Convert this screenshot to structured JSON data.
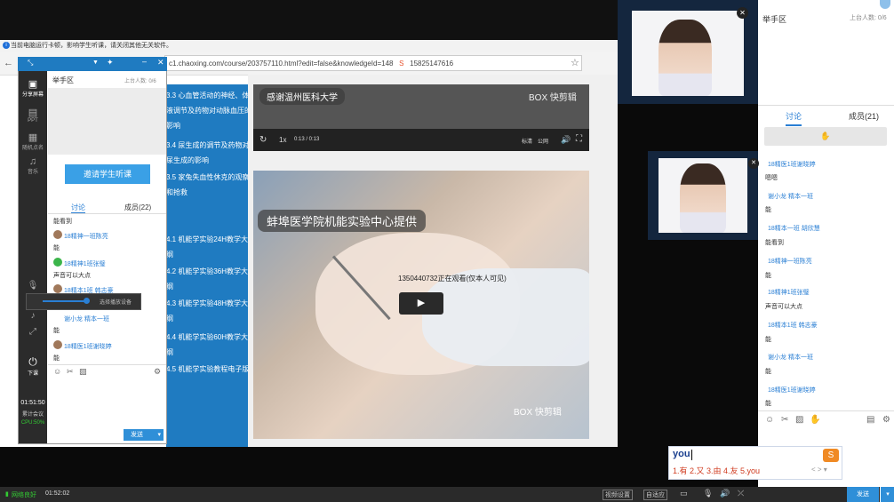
{
  "warning": "当前电脑运行卡顿，影响学生听课，请关闭其他无关软件。",
  "browser": {
    "url": "c1.chaoxing.com/course/203757110.html?edit=false&knowledgeId=148",
    "url_tail": "15825147616"
  },
  "tree": [
    "3.3 心血管活动的神经、体",
    "液调节及药物对动脉血压的",
    "影响",
    "3.4 尿生成的调节及药物对",
    "尿生成的影响",
    "3.5 家兔失血性休克的观察",
    "和抢救",
    "4.1 机能学实验24H教学大",
    "纲",
    "4.2 机能学实验36H教学大",
    "纲",
    "4.3 机能学实验48H教学大",
    "纲",
    "4.4 机能学实验60H教学大",
    "纲",
    "4.5 机能学实验教程电子版"
  ],
  "video1": {
    "tag": "感谢温州医科大学",
    "brand": "BOX 快剪辑",
    "speed": "1x",
    "time": "0:13 / 0:13",
    "mode": "标清",
    "public": "公网"
  },
  "video2": {
    "tag": "蚌埠医学院机能实验中心提供",
    "watermark": "1350440732正在观看(仅本人可见)",
    "brand": "BOX 快剪辑"
  },
  "panel": {
    "title": "举手区",
    "stage_count": "上台人数: 0/6",
    "invite": "邀请学生听课",
    "tab_discuss": "讨论",
    "tab_members": "成员(22)",
    "side": [
      "分享屏幕",
      "PPT",
      "随机点名",
      "音乐",
      "下课"
    ],
    "timer": "01:51:50",
    "timer_label": "累计会议",
    "cpu": "CPU:50%",
    "select_device": "选择播放设备",
    "send": "发送",
    "messages": [
      {
        "name": "",
        "text": "能看到"
      },
      {
        "name": "18精神一班陈亮",
        "text": "能"
      },
      {
        "name": "18精神1班张璧",
        "text": "声音可以大点"
      },
      {
        "name": "18精本1班 韩志豪",
        "text": ""
      },
      {
        "name": "谢小龙 精本一班",
        "text": "能"
      },
      {
        "name": "18精医1班谢晓婷",
        "text": "能"
      }
    ]
  },
  "right": {
    "title": "举手区",
    "stage_count": "上台人数: 0/6",
    "tab_discuss": "讨论",
    "tab_members": "成员(21)",
    "send": "发送",
    "messages": [
      {
        "name": "18精医1班谢晓婷",
        "text": "嗯嗯"
      },
      {
        "name": "谢小龙 精本一班",
        "text": "能"
      },
      {
        "name": "18精本一班 胡欣慧",
        "text": "能看到"
      },
      {
        "name": "18精神一班陈亮",
        "text": "能"
      },
      {
        "name": "18精神1班张璧",
        "text": "声音可以大点"
      },
      {
        "name": "18精本1班 韩志豪",
        "text": "能"
      },
      {
        "name": "谢小龙 精本一班",
        "text": "能"
      },
      {
        "name": "18精医1班谢晓婷",
        "text": "能"
      }
    ]
  },
  "ime": {
    "input": "you",
    "candidates": "1.有  2.又  3.由  4.友  5.you"
  },
  "bottom": {
    "network": "网络良好",
    "time": "01:52:02",
    "video_settings": "视频设置",
    "self_view": "自适应"
  },
  "colors": {
    "accent": "#1f7bc1",
    "link": "#2a7fd4",
    "send": "#2f8fd8"
  }
}
